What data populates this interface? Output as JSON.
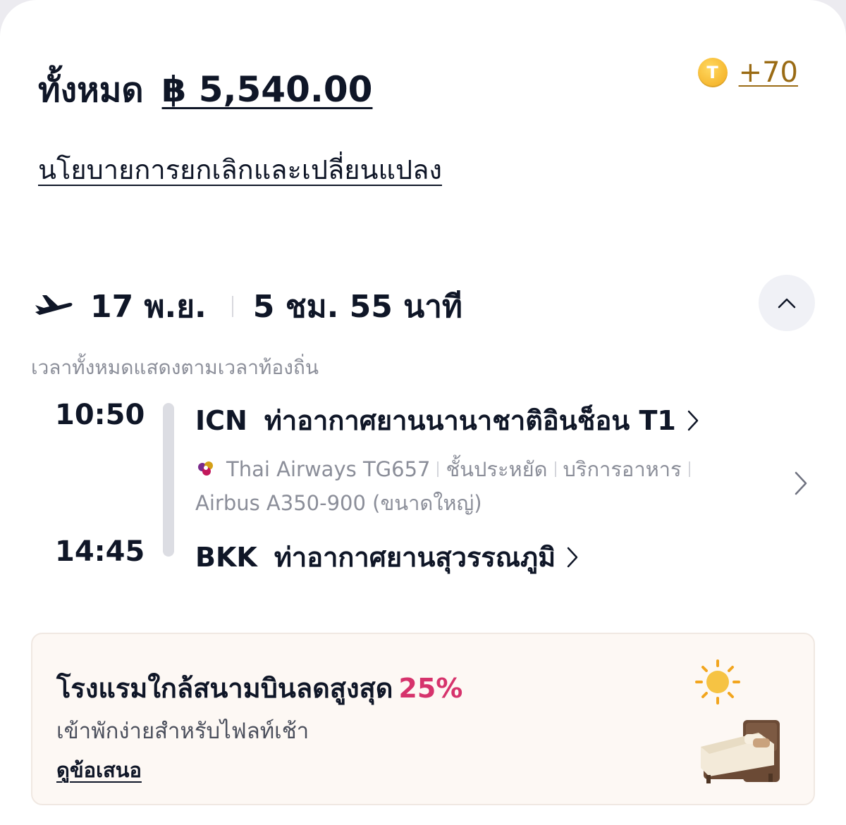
{
  "summary": {
    "total_label": "ทั้งหมด",
    "total_price": "฿ 5,540.00",
    "points": "+70",
    "points_coin": "T",
    "policy_link": "นโยบายการยกเลิกและเปลี่ยนแปลง"
  },
  "flight": {
    "date": "17 พ.ย.",
    "duration": "5 ชม. 55 นาที",
    "local_time_note": "เวลาทั้งหมดแสดงตามเวลาท้องถิ่น",
    "departure": {
      "time": "10:50",
      "code": "ICN",
      "airport": "ท่าอากาศยานนานาชาติอินช็อน T1"
    },
    "arrival": {
      "time": "14:45",
      "code": "BKK",
      "airport": "ท่าอากาศยานสุวรรณภูมิ"
    },
    "details": {
      "airline": "Thai Airways TG657",
      "cabin": "ชั้นประหยัด",
      "meal": "บริการอาหาร",
      "aircraft": "Airbus A350-900 (ขนาดใหญ่)"
    }
  },
  "promo": {
    "title": "โรงแรมใกล้สนามบินลดสูงสุด",
    "percent": "25%",
    "subtitle": "เข้าพักง่ายสำหรับไฟลท์เช้า",
    "link": "ดูข้อเสนอ"
  },
  "icons": {
    "plane": "plane-icon",
    "collapse": "chevron-up-icon",
    "airport_chevron": "chevron-right-icon",
    "airline_logo": "thai-airways-logo-icon",
    "promo_art": "sun-bed-illustration-icon"
  },
  "colors": {
    "points_gold": "#9a6b14",
    "promo_accent": "#d6336c",
    "muted_text": "#8b8e99",
    "promo_bg": "#fdf8f4"
  }
}
